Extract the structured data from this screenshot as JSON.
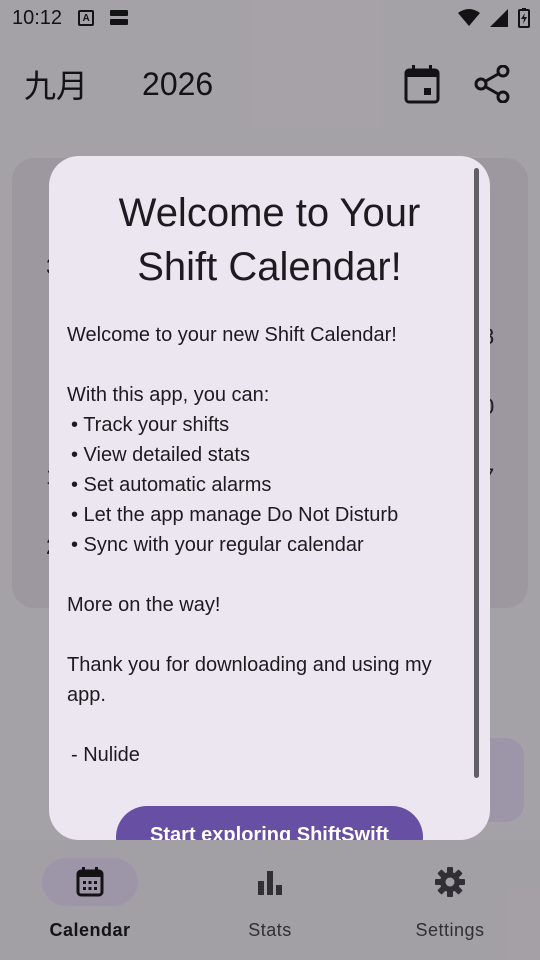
{
  "status_bar": {
    "time": "10:12",
    "badge_letter": "A"
  },
  "app_bar": {
    "month": "九月",
    "year": "2026"
  },
  "calendar_background": {
    "row_numbers": [
      "3",
      "8",
      "0",
      "7",
      "1",
      "2"
    ]
  },
  "dialog": {
    "title_line1": "Welcome to Your",
    "title_line2": "Shift Calendar!",
    "intro": "Welcome to your new Shift Calendar!",
    "lead": "With this app, you can:",
    "bullets": [
      "• Track your shifts",
      "• View detailed stats",
      "• Set automatic alarms",
      "• Let the app manage Do Not Disturb",
      "• Sync with your regular calendar"
    ],
    "more": "More on the way!",
    "thanks": "Thank you for downloading and using my app.",
    "signature": "- Nulide",
    "button_label": "Start exploring ShiftSwift"
  },
  "bottom_nav": {
    "items": [
      {
        "label": "Calendar",
        "icon": "calendar-icon",
        "active": true
      },
      {
        "label": "Stats",
        "icon": "bar-chart-icon",
        "active": false
      },
      {
        "label": "Settings",
        "icon": "gear-icon",
        "active": false
      }
    ]
  },
  "colors": {
    "primary": "#6750a4",
    "dialog_surface": "#ece6f0",
    "nav_indicator": "#e8def8"
  }
}
